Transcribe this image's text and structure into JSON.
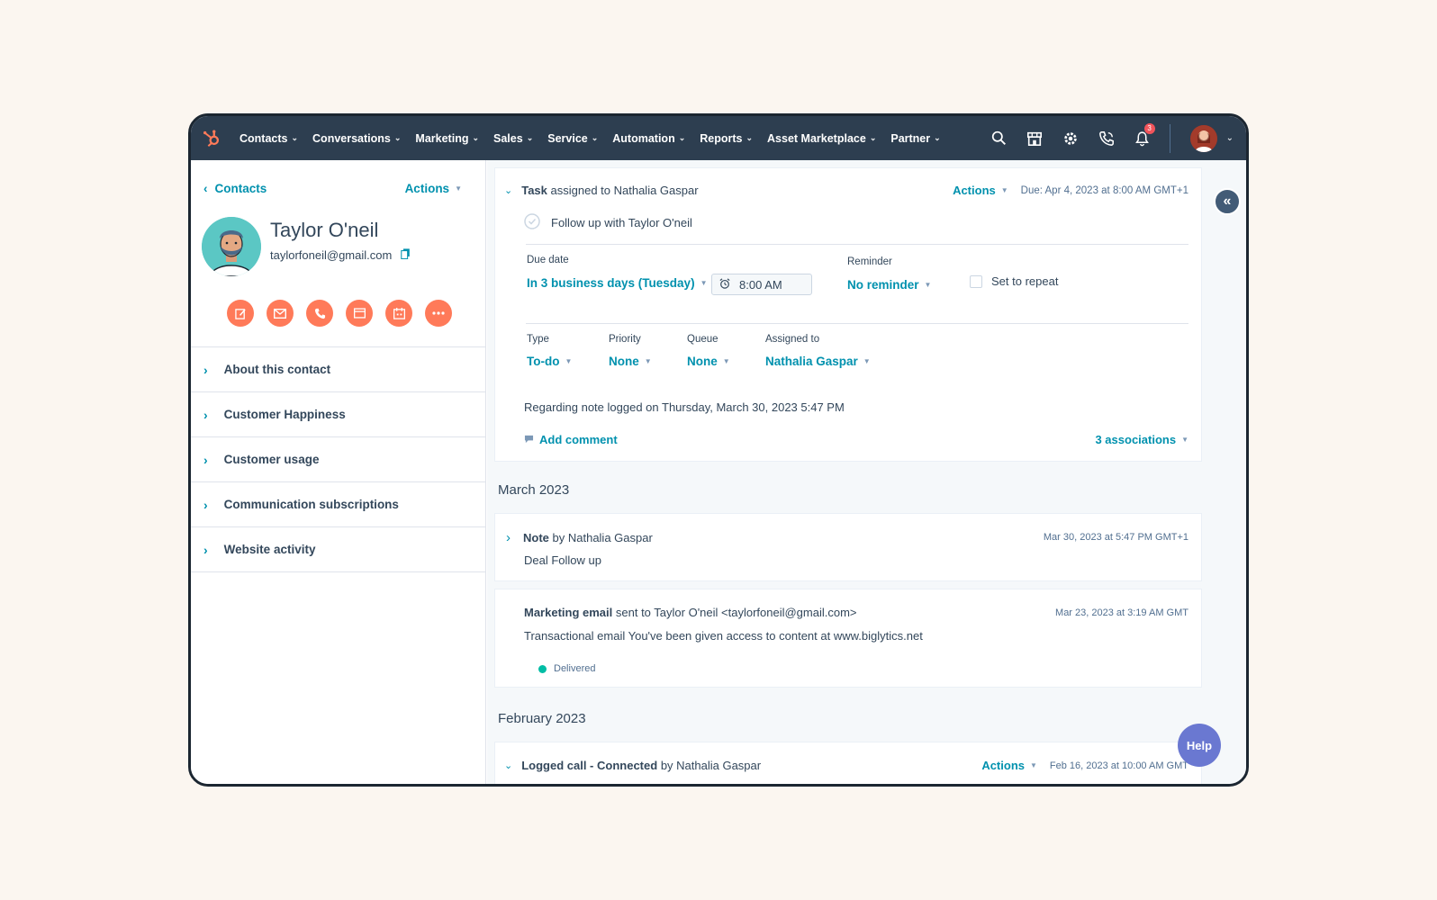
{
  "nav": {
    "items": [
      "Contacts",
      "Conversations",
      "Marketing",
      "Sales",
      "Service",
      "Automation",
      "Reports",
      "Asset Marketplace",
      "Partner"
    ],
    "notification_count": "3"
  },
  "sidebar": {
    "back_label": "Contacts",
    "actions_label": "Actions",
    "name": "Taylor O'neil",
    "email": "taylorfoneil@gmail.com",
    "sections": [
      "About this contact",
      "Customer Happiness",
      "Customer usage",
      "Communication subscriptions",
      "Website activity"
    ]
  },
  "task": {
    "type_word": "Task",
    "assigned_text": "assigned to Nathalia Gaspar",
    "actions_label": "Actions",
    "due": "Due: Apr 4, 2023 at 8:00 AM GMT+1",
    "title": "Follow up with Taylor O'neil",
    "due_date_label": "Due date",
    "due_date_value": "In 3 business days (Tuesday)",
    "time_value": "8:00 AM",
    "reminder_label": "Reminder",
    "reminder_value": "No reminder",
    "repeat_label": "Set to repeat",
    "type_label": "Type",
    "type_value": "To-do",
    "priority_label": "Priority",
    "priority_value": "None",
    "queue_label": "Queue",
    "queue_value": "None",
    "assigned_label": "Assigned to",
    "assigned_value": "Nathalia Gaspar",
    "regarding": "Regarding note logged on Thursday, March 30, 2023 5:47 PM",
    "add_comment": "Add comment",
    "associations": "3 associations"
  },
  "timeline": {
    "month1": "March 2023",
    "note": {
      "type_word": "Note",
      "by": "by Nathalia Gaspar",
      "timestamp": "Mar 30, 2023 at 5:47 PM GMT+1",
      "body": "Deal Follow up"
    },
    "email": {
      "type_word": "Marketing email",
      "sent_to": "sent to Taylor O'neil <taylorfoneil@gmail.com>",
      "timestamp": "Mar 23, 2023 at 3:19 AM GMT",
      "body": "Transactional email You've been given access to content at www.biglytics.net",
      "status": "Delivered"
    },
    "month2": "February 2023",
    "call": {
      "type_word": "Logged call - Connected",
      "by": "by Nathalia Gaspar",
      "actions_label": "Actions",
      "timestamp": "Feb 16, 2023 at 10:00 AM GMT"
    }
  },
  "help_label": "Help",
  "colors": {
    "nav_bg": "#2d3e50",
    "accent": "#0091ae",
    "brand_orange": "#ff7a59",
    "help": "#6a78d1"
  }
}
